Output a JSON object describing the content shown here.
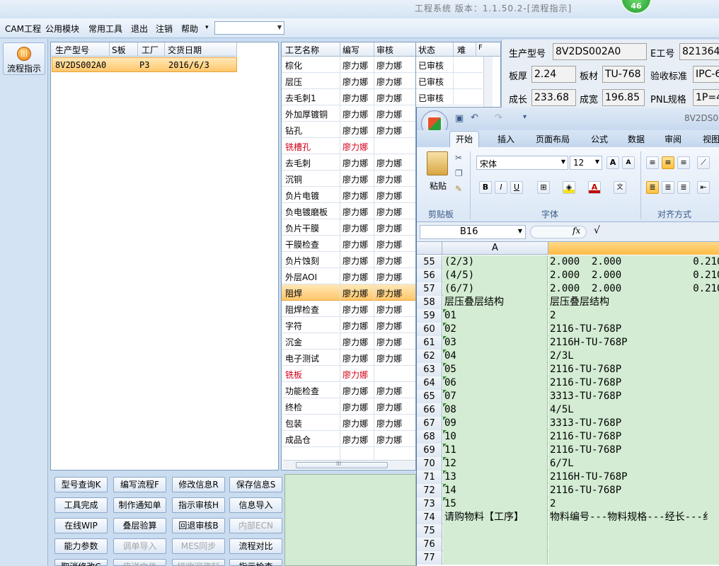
{
  "app": {
    "title": "工程系统 版本：1.1.50.2-[流程指示]",
    "badge": "46"
  },
  "menu": {
    "items": [
      "CAM工程",
      "公用模块",
      "常用工具",
      "退出",
      "注销",
      "帮助"
    ],
    "help_arrow": "▾",
    "combo_value": ""
  },
  "sidebar": {
    "flow_label": "流程指示"
  },
  "orders": {
    "headers": [
      "生产型号",
      "S板",
      "工厂",
      "交货日期"
    ],
    "rows": [
      {
        "model": "8V2DS002A0",
        "s": "",
        "factory": "P3",
        "date": "2016/6/3"
      }
    ]
  },
  "process": {
    "headers": [
      "工艺名称",
      "编写",
      "审核",
      "状态",
      "难",
      "F"
    ],
    "rows": [
      {
        "name": "棕化",
        "writer": "廖力娜",
        "reviewer": "廖力娜",
        "status": "已审核"
      },
      {
        "name": "层压",
        "writer": "廖力娜",
        "reviewer": "廖力娜",
        "status": "已审核"
      },
      {
        "name": "去毛刺1",
        "writer": "廖力娜",
        "reviewer": "廖力娜",
        "status": "已审核"
      },
      {
        "name": "外加厚镀铜",
        "writer": "廖力娜",
        "reviewer": "廖力娜",
        "status": ""
      },
      {
        "name": "钻孔",
        "writer": "廖力娜",
        "reviewer": "廖力娜",
        "status": ""
      },
      {
        "name": "铣槽孔",
        "writer": "廖力娜",
        "reviewer": "",
        "status": "",
        "red": true
      },
      {
        "name": "去毛刺",
        "writer": "廖力娜",
        "reviewer": "廖力娜",
        "status": ""
      },
      {
        "name": "沉铜",
        "writer": "廖力娜",
        "reviewer": "廖力娜",
        "status": ""
      },
      {
        "name": "负片电镀",
        "writer": "廖力娜",
        "reviewer": "廖力娜",
        "status": ""
      },
      {
        "name": "负电镀磨板",
        "writer": "廖力娜",
        "reviewer": "廖力娜",
        "status": ""
      },
      {
        "name": "负片干膜",
        "writer": "廖力娜",
        "reviewer": "廖力娜",
        "status": ""
      },
      {
        "name": "干膜检查",
        "writer": "廖力娜",
        "reviewer": "廖力娜",
        "status": ""
      },
      {
        "name": "负片蚀刻",
        "writer": "廖力娜",
        "reviewer": "廖力娜",
        "status": ""
      },
      {
        "name": "外层AOI",
        "writer": "廖力娜",
        "reviewer": "廖力娜",
        "status": ""
      },
      {
        "name": "阻焊",
        "writer": "廖力娜",
        "reviewer": "廖力娜",
        "status": "",
        "selected": true
      },
      {
        "name": "阻焊检查",
        "writer": "廖力娜",
        "reviewer": "廖力娜",
        "status": ""
      },
      {
        "name": "字符",
        "writer": "廖力娜",
        "reviewer": "廖力娜",
        "status": ""
      },
      {
        "name": "沉金",
        "writer": "廖力娜",
        "reviewer": "廖力娜",
        "status": ""
      },
      {
        "name": "电子测试",
        "writer": "廖力娜",
        "reviewer": "廖力娜",
        "status": ""
      },
      {
        "name": "铣板",
        "writer": "廖力娜",
        "reviewer": "",
        "status": "",
        "red": true
      },
      {
        "name": "功能检查",
        "writer": "廖力娜",
        "reviewer": "廖力娜",
        "status": ""
      },
      {
        "name": "终检",
        "writer": "廖力娜",
        "reviewer": "廖力娜",
        "status": ""
      },
      {
        "name": "包装",
        "writer": "廖力娜",
        "reviewer": "廖力娜",
        "status": ""
      },
      {
        "name": "成品仓",
        "writer": "廖力娜",
        "reviewer": "廖力娜",
        "status": ""
      }
    ],
    "scroll_grip": "III"
  },
  "buttons": [
    {
      "label": "型号查询K",
      "enabled": true
    },
    {
      "label": "编写流程F",
      "enabled": true
    },
    {
      "label": "修改信息R",
      "enabled": true
    },
    {
      "label": "保存信息S",
      "enabled": true
    },
    {
      "label": "工具完成",
      "enabled": true
    },
    {
      "label": "制作通知单",
      "enabled": true
    },
    {
      "label": "指示审核H",
      "enabled": true
    },
    {
      "label": "信息导入",
      "enabled": true
    },
    {
      "label": "在线WIP",
      "enabled": true
    },
    {
      "label": "叠层验算",
      "enabled": true
    },
    {
      "label": "回退审核B",
      "enabled": true
    },
    {
      "label": "内部ECN",
      "enabled": false
    },
    {
      "label": "能力参数",
      "enabled": true
    },
    {
      "label": "调单导入",
      "enabled": false
    },
    {
      "label": "MES同步",
      "enabled": false
    },
    {
      "label": "流程对比",
      "enabled": true
    },
    {
      "label": "取消修改C",
      "enabled": true
    },
    {
      "label": "传送文件",
      "enabled": false
    },
    {
      "label": "接收迎资料",
      "enabled": false
    },
    {
      "label": "指示检查",
      "enabled": true
    }
  ],
  "info": {
    "labels": {
      "model": "生产型号",
      "eno": "E工号",
      "thickness": "板厚",
      "material": "板材",
      "standard": "验收标准",
      "length": "成长",
      "width": "成宽",
      "pnl": "PNL规格"
    },
    "values": {
      "model": "8V2DS002A0",
      "eno": "821364",
      "thickness": "2.24",
      "material": "TU-768",
      "standard": "IPC-6",
      "length": "233.68",
      "width": "196.85",
      "pnl": "1P=4"
    }
  },
  "excel": {
    "title": "8V2DS00",
    "tabs": [
      "开始",
      "插入",
      "页面布局",
      "公式",
      "数据",
      "审阅",
      "视图"
    ],
    "font_name": "宋体",
    "font_size": "12",
    "paste_label": "粘贴",
    "groups": {
      "clipboard": "剪贴板",
      "font": "字体",
      "align": "对齐方式"
    },
    "cell_ref": "B16",
    "fx": "fx",
    "formula_check": "√",
    "col_a": "A",
    "rows": [
      {
        "n": "55",
        "a": "(2/3)",
        "b": "2.000  2.000            0.210",
        "tri": false
      },
      {
        "n": "56",
        "a": "(4/5)",
        "b": "2.000  2.000            0.210",
        "tri": false
      },
      {
        "n": "57",
        "a": "(6/7)",
        "b": "2.000  2.000            0.210",
        "tri": false
      },
      {
        "n": "58",
        "a": "层压叠层结构",
        "b": "层压叠层结构",
        "tri": false
      },
      {
        "n": "59",
        "a": "01",
        "b": "2",
        "tri": true
      },
      {
        "n": "60",
        "a": "02",
        "b": "2116-TU-768P",
        "tri": true
      },
      {
        "n": "61",
        "a": "03",
        "b": "2116H-TU-768P",
        "tri": true
      },
      {
        "n": "62",
        "a": "04",
        "b": "2/3L",
        "tri": true
      },
      {
        "n": "63",
        "a": "05",
        "b": "2116-TU-768P",
        "tri": true
      },
      {
        "n": "64",
        "a": "06",
        "b": "2116-TU-768P",
        "tri": true
      },
      {
        "n": "65",
        "a": "07",
        "b": "3313-TU-768P",
        "tri": true
      },
      {
        "n": "66",
        "a": "08",
        "b": "4/5L",
        "tri": true
      },
      {
        "n": "67",
        "a": "09",
        "b": "3313-TU-768P",
        "tri": true
      },
      {
        "n": "68",
        "a": "10",
        "b": "2116-TU-768P",
        "tri": true
      },
      {
        "n": "69",
        "a": "11",
        "b": "2116-TU-768P",
        "tri": true
      },
      {
        "n": "70",
        "a": "12",
        "b": "6/7L",
        "tri": true
      },
      {
        "n": "71",
        "a": "13",
        "b": "2116H-TU-768P",
        "tri": true
      },
      {
        "n": "72",
        "a": "14",
        "b": "2116-TU-768P",
        "tri": true
      },
      {
        "n": "73",
        "a": "15",
        "b": "2",
        "tri": true
      },
      {
        "n": "74",
        "a": "请购物料【工序】",
        "b": "物料编号---物料规格---经长---纟",
        "tri": false
      },
      {
        "n": "75",
        "a": "",
        "b": "",
        "tri": false
      },
      {
        "n": "76",
        "a": "",
        "b": "",
        "tri": false
      },
      {
        "n": "77",
        "a": "",
        "b": "",
        "tri": false
      }
    ]
  },
  "colors": {
    "accent": "#ffc66a",
    "red_text": "#d0021b",
    "sheet_green": "#d3ecd3"
  }
}
